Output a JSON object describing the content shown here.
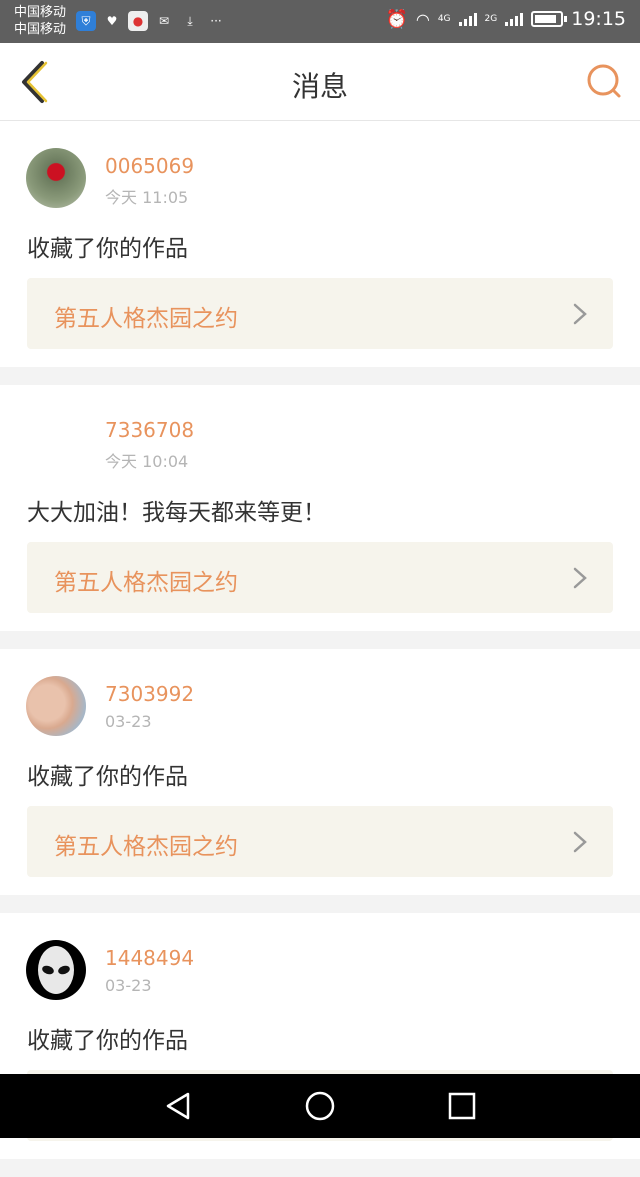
{
  "status_bar": {
    "carrier_1": "中国移动",
    "carrier_2": "中国移动",
    "time": "19:15",
    "network_1": "4G",
    "network_2": "2G",
    "more": "···",
    "battery_level": 0.85
  },
  "header": {
    "title": "消息",
    "back_icon": "chevron-left-icon",
    "search_icon": "search-icon"
  },
  "messages": [
    {
      "user_id": "0065069",
      "time": "今天 11:05",
      "text": "收藏了你的作品",
      "work_title": "第五人格杰园之约",
      "has_avatar": true
    },
    {
      "user_id": "7336708",
      "time": "今天 10:04",
      "text": "大大加油！我每天都来等更！",
      "work_title": "第五人格杰园之约",
      "has_avatar": false
    },
    {
      "user_id": "7303992",
      "time": "03-23",
      "text": "收藏了你的作品",
      "work_title": "第五人格杰园之约",
      "has_avatar": true
    },
    {
      "user_id": "1448494",
      "time": "03-23",
      "text": "收藏了你的作品",
      "work_title": "",
      "has_avatar": true
    }
  ],
  "colors": {
    "accent": "#e8935d",
    "header_bg": "#ffffff",
    "page_bg": "#f3f3f3",
    "work_bg": "#f6f4ec"
  },
  "nav_bar": {
    "back_icon": "triangle-back-icon",
    "home_icon": "circle-home-icon",
    "recents_icon": "square-recents-icon"
  }
}
